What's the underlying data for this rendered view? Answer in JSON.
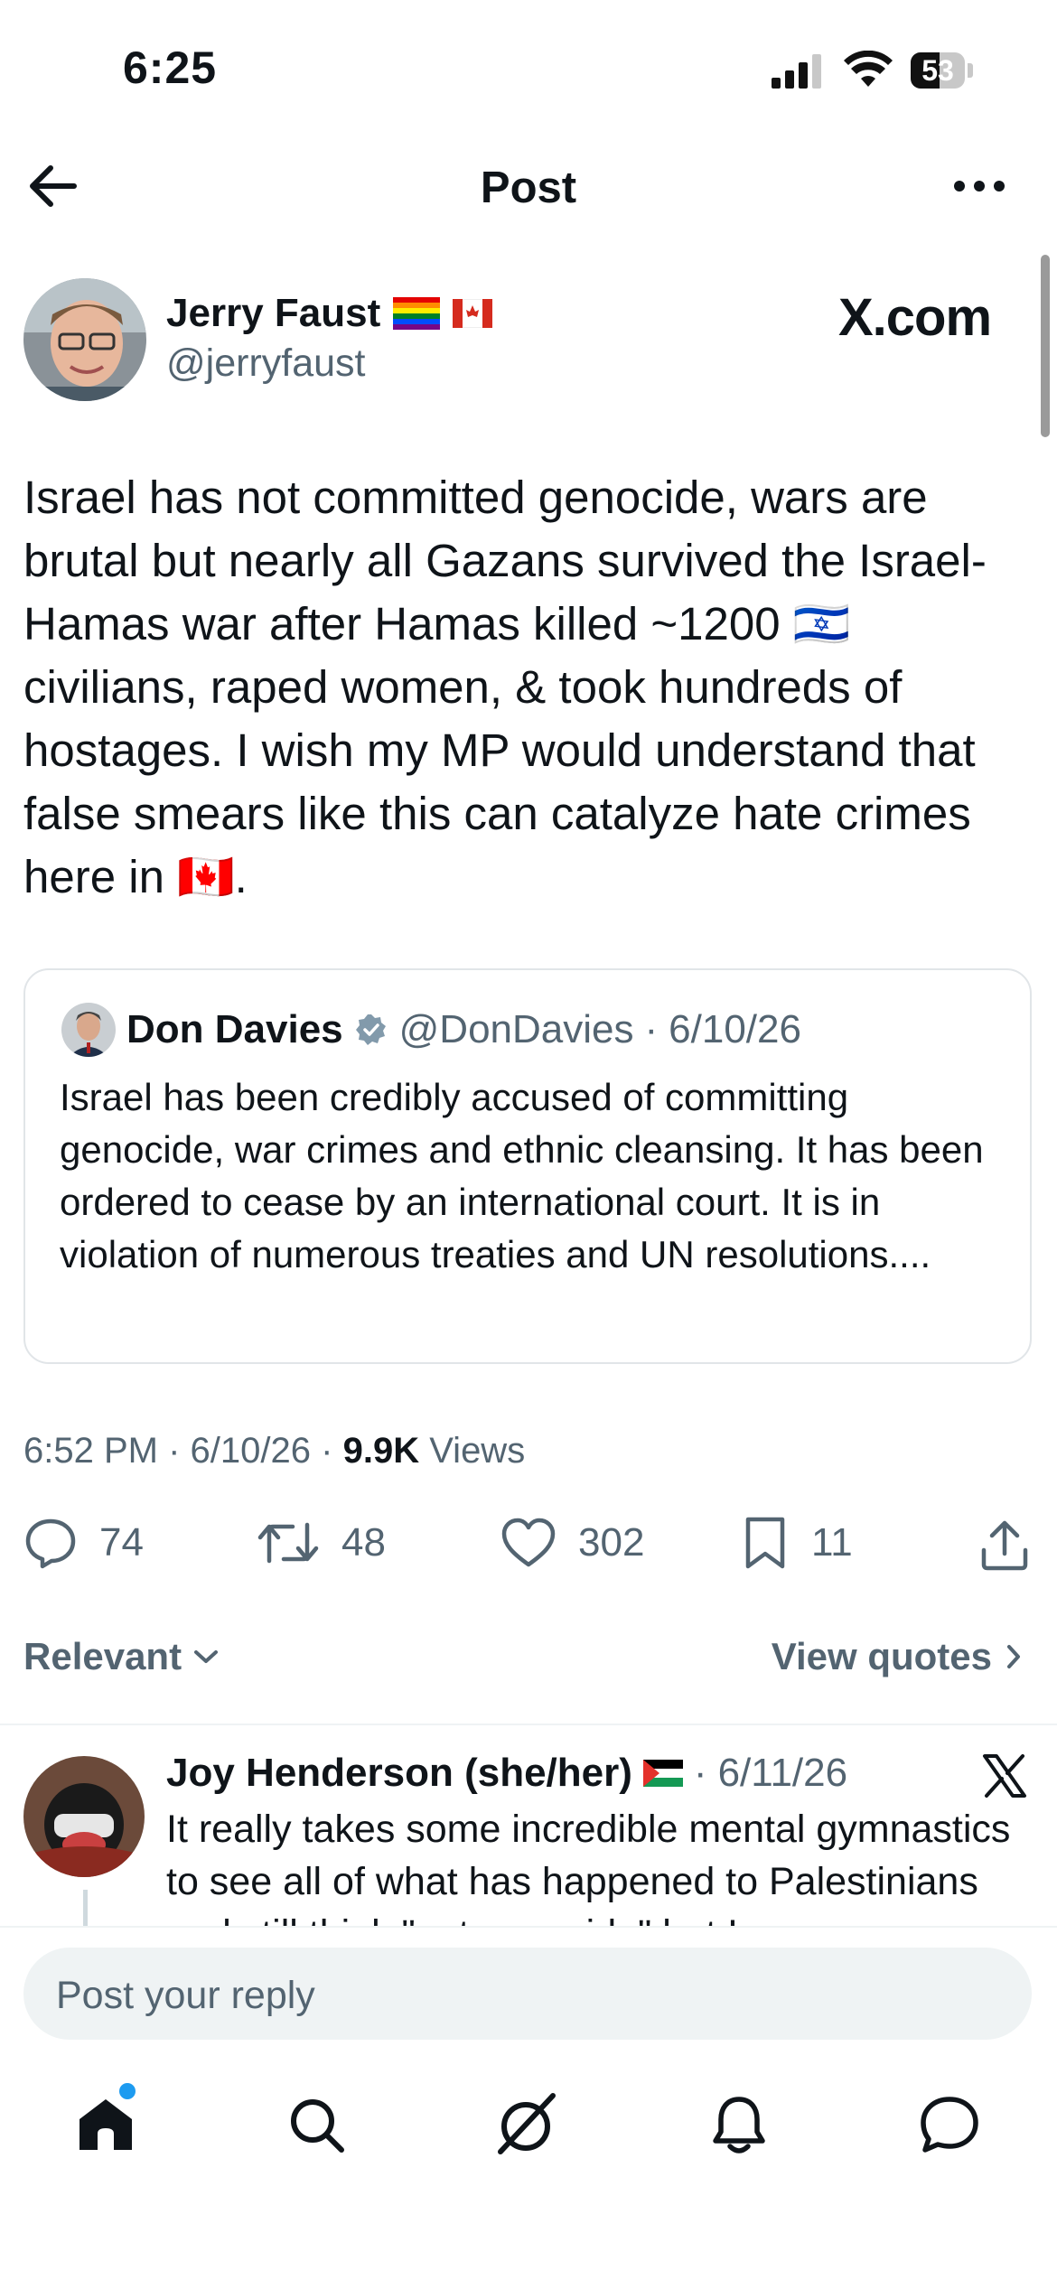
{
  "status_bar": {
    "time": "6:25",
    "battery_level": "53",
    "battery_fraction": 0.53
  },
  "header": {
    "title": "Post"
  },
  "post": {
    "author_name": "Jerry Faust",
    "author_handle": "@jerryfaust",
    "source_logo": "X.com",
    "text": "Israel has not committed genocide, wars are brutal but nearly all Gazans survived the Israel-\nHamas war after Hamas killed ~1200 🇮🇱\ncivilians, raped women, & took hundreds of hostages.  I wish my MP would understand that false smears like this can catalyze hate crimes here in 🇨🇦.",
    "quote": {
      "name": "Don Davies",
      "handle": "@DonDavies",
      "separator": "·",
      "date": "6/10/26",
      "text": "Israel has been credibly accused of committing genocide, war crimes and ethnic cleansing. It has been ordered to cease by an international court. It is in violation of numerous treaties and UN resolutions...."
    },
    "meta": {
      "time": "6:52 PM",
      "sep": "·",
      "date": "6/10/26",
      "views_count": "9.9K",
      "views_label": "Views"
    },
    "actions": {
      "replies": "74",
      "reposts": "48",
      "likes": "302",
      "bookmarks": "11"
    }
  },
  "sort": {
    "label": "Relevant",
    "view_quotes": "View quotes"
  },
  "reply": {
    "name": "Joy Henderson (she/her)",
    "separator": "·",
    "date": "6/11/26",
    "text": "It really takes some incredible mental gymnastics to see all of what has happened to Palestinians and still think \"not genocide\" but I"
  },
  "composer": {
    "placeholder": "Post your reply"
  },
  "colors": {
    "accent": "#1d9bf0",
    "text": "#0f1419",
    "secondary": "#536471",
    "verified": "#829aab"
  },
  "icons": [
    "back-arrow-icon",
    "more-icon",
    "verified-icon",
    "reply-icon",
    "repost-icon",
    "like-icon",
    "bookmark-icon",
    "share-icon",
    "chevron-down-icon",
    "chevron-right-icon",
    "x-logo-icon",
    "home-icon",
    "search-icon",
    "grok-icon",
    "notifications-icon",
    "messages-icon"
  ]
}
